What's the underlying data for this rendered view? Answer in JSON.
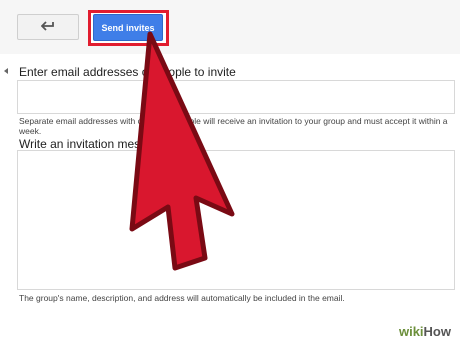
{
  "toolbar": {
    "back_icon": "back-arrow-icon",
    "send_label": "Send invites"
  },
  "form": {
    "email_label": "Enter email addresses of people to invite",
    "email_value": "",
    "email_hint": "Separate email addresses with commas. People will receive an invitation to your group and must accept it within a week.",
    "message_label": "Write an invitation message",
    "message_value": "",
    "footer_note": "The group's name, description, and address will automatically be included in the email."
  },
  "overlay": {
    "pointer_icon": "red-arrow-pointer-icon",
    "watermark_part1": "wiki",
    "watermark_part2": "How"
  },
  "colors": {
    "accent_button": "#3f7ee8",
    "highlight_red": "#e11d2f",
    "pointer_red": "#d9172e"
  }
}
